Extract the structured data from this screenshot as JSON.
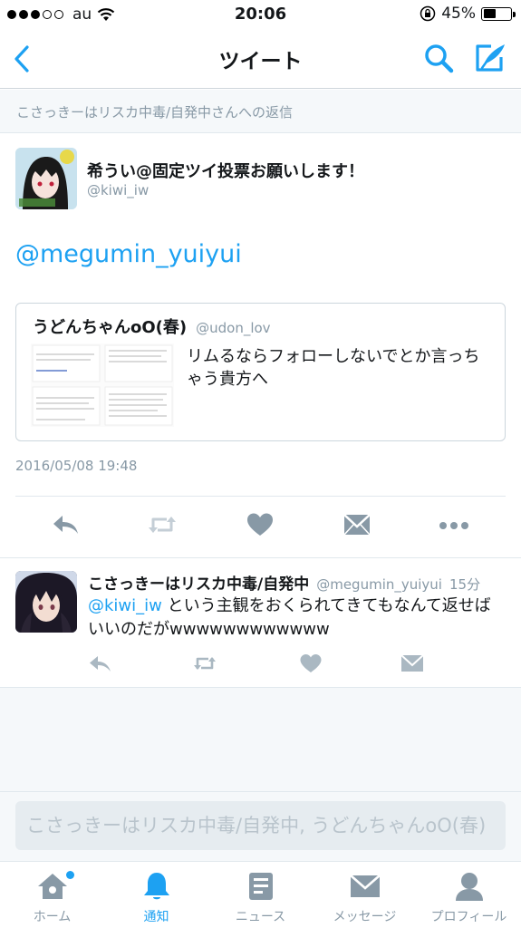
{
  "status_bar": {
    "carrier": "au",
    "time": "20:06",
    "battery_percent": "45%",
    "battery_level": 0.45,
    "signal_bars_filled": 3,
    "signal_bars_total": 5
  },
  "nav": {
    "title": "ツイート",
    "back_icon": "chevron-left-icon",
    "search_icon": "search-icon",
    "compose_icon": "compose-icon"
  },
  "reply_context": "こさっきーはリスカ中毒/自発中さんへの返信",
  "main_tweet": {
    "name": "希うい@固定ツイ投票お願いします！",
    "handle": "@kiwi_iw",
    "text": "@megumin_yuiyui",
    "quote": {
      "name": "うどんちゃんoO(春)",
      "handle": "@udon_lov",
      "text": "リムるならフォローしないでとか言っちゃう貴方へ"
    },
    "date": "2016/05/08 19:48"
  },
  "reply_tweet": {
    "name": "こさっきーはリスカ中毒/自発中",
    "handle": "@megumin_yuiyui",
    "time": "15分",
    "mention": "@kiwi_iw",
    "text": " という主観をおくられてきてもなんて返せばいいのだがwwwwwwwwwwww"
  },
  "reply_input": {
    "placeholder": "こさっきーはリスカ中毒/自発中, うどんちゃんoO(春)"
  },
  "tabs": [
    {
      "label": "ホーム",
      "icon": "home-icon",
      "active": false
    },
    {
      "label": "通知",
      "icon": "bell-icon",
      "active": true
    },
    {
      "label": "ニュース",
      "icon": "news-icon",
      "active": false
    },
    {
      "label": "メッセージ",
      "icon": "envelope-icon",
      "active": false
    },
    {
      "label": "プロフィール",
      "icon": "person-icon",
      "active": false
    }
  ],
  "colors": {
    "accent": "#1da1f2",
    "muted": "#8899a6",
    "icon_gray": "#657786",
    "light_icon": "#aab8c2"
  }
}
